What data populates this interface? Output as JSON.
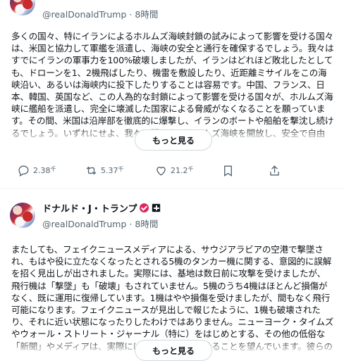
{
  "posts": [
    {
      "handle": "@realDonaldTrump",
      "separator": "·",
      "time": "8時間",
      "text": "多くの国々、特にイランによるホルムズ海峡封鎖の試みによって影響を受ける国々は、米国と協力して軍艦を派遣し、海峡の安全と通行を確保するでしょう。我々はすでにイランの軍事力を100%破壊しましたが、イランはどれほど敗北したとしても、ドローンを1、2機飛ばしたり、機雷を敷設したり、近距離ミサイルをこの海峡沿い、あるいは海峡内に投下したりすることは容易です。中国、フランス、日本、韓国、英国など、この人為的な封鎖によって影響を受ける国々が、ホルムズ海峡に艦船を派遣し、完全に壊滅した国家による脅威がなくなることを願っています。その間、米国は沿岸部を徹底的に爆撃し、イランのボートや船舶を撃沈し続けるでしょう。いずれにせよ、我々は間もなくホルムズ海峡を開放し、安全で自由",
      "more_label": "もっと見る",
      "stats": {
        "replies": "2.38",
        "replies_unit": "千",
        "reposts": "5.37",
        "reposts_unit": "千",
        "likes": "21.2",
        "likes_unit": "千"
      }
    },
    {
      "display_name": "ドナルド・J・トランプ",
      "handle": "@realDonaldTrump",
      "separator": "·",
      "time": "8時間",
      "text": "またしても、フェイクニュースメディアによる、サウジアラビアの空港で撃墜され、もはや役に立たなくなったとされる5機のタンカー機に関する、意図的に誤解を招く見出しが出されました。実際には、基地は数日前に攻撃を受けましたが、飛行機は「撃墜」も「破壊」もされていません。5機のうち4機はほとんど損傷がなく、既に運用に復帰しています。1機はやや損傷を受けましたが、間もなく飛行可能になります。フェイクニュースが見出しで報じたように、1機も破壊されたり、それに近い状態になったりしたわけではありません。ニューヨーク・タイムズやウォール・ストリート・ジャーナル（特に）をはじめとする、その他の低俗な「新聞」やメディアは、実際には我々が戦争に負けることを望んでいます。彼らのひどい報道は、実際の事実",
      "more_label": "もっと見る"
    }
  ],
  "icons": {
    "reply": "reply-icon",
    "repost": "repost-icon",
    "like": "heart-icon",
    "bookmark": "bookmark-icon",
    "share": "share-icon",
    "verified": "verified-badge-icon",
    "affiliate": "affiliate-badge-icon"
  },
  "colors": {
    "text": "#0f1419",
    "muted": "#536471",
    "border": "#cfd9de",
    "verified": "#e0245e"
  }
}
